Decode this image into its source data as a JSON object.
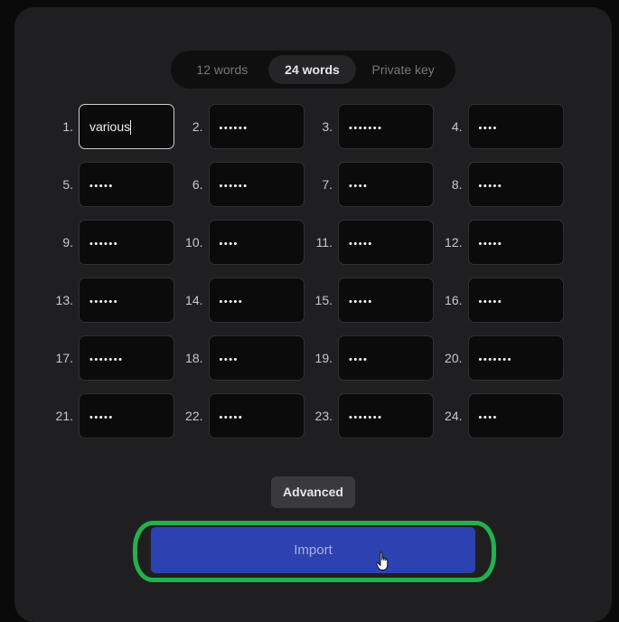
{
  "tabs": [
    {
      "label": "12 words",
      "active": false
    },
    {
      "label": "24 words",
      "active": true
    },
    {
      "label": "Private key",
      "active": false
    }
  ],
  "words": [
    {
      "index": "1.",
      "value": "various",
      "masked": false,
      "focused": true
    },
    {
      "index": "2.",
      "value": "••••••",
      "masked": true
    },
    {
      "index": "3.",
      "value": "•••••••",
      "masked": true
    },
    {
      "index": "4.",
      "value": "••••",
      "masked": true
    },
    {
      "index": "5.",
      "value": "•••••",
      "masked": true
    },
    {
      "index": "6.",
      "value": "••••••",
      "masked": true
    },
    {
      "index": "7.",
      "value": "••••",
      "masked": true
    },
    {
      "index": "8.",
      "value": "•••••",
      "masked": true
    },
    {
      "index": "9.",
      "value": "••••••",
      "masked": true
    },
    {
      "index": "10.",
      "value": "••••",
      "masked": true
    },
    {
      "index": "11.",
      "value": "•••••",
      "masked": true
    },
    {
      "index": "12.",
      "value": "•••••",
      "masked": true
    },
    {
      "index": "13.",
      "value": "••••••",
      "masked": true
    },
    {
      "index": "14.",
      "value": "•••••",
      "masked": true
    },
    {
      "index": "15.",
      "value": "•••••",
      "masked": true
    },
    {
      "index": "16.",
      "value": "•••••",
      "masked": true
    },
    {
      "index": "17.",
      "value": "•••••••",
      "masked": true
    },
    {
      "index": "18.",
      "value": "••••",
      "masked": true
    },
    {
      "index": "19.",
      "value": "••••",
      "masked": true
    },
    {
      "index": "20.",
      "value": "•••••••",
      "masked": true
    },
    {
      "index": "21.",
      "value": "•••••",
      "masked": true
    },
    {
      "index": "22.",
      "value": "•••••",
      "masked": true
    },
    {
      "index": "23.",
      "value": "•••••••",
      "masked": true
    },
    {
      "index": "24.",
      "value": "••••",
      "masked": true
    }
  ],
  "buttons": {
    "advanced": "Advanced",
    "import": "Import"
  },
  "colors": {
    "import_bg": "#2c42b0",
    "highlight": "#22b14c"
  }
}
